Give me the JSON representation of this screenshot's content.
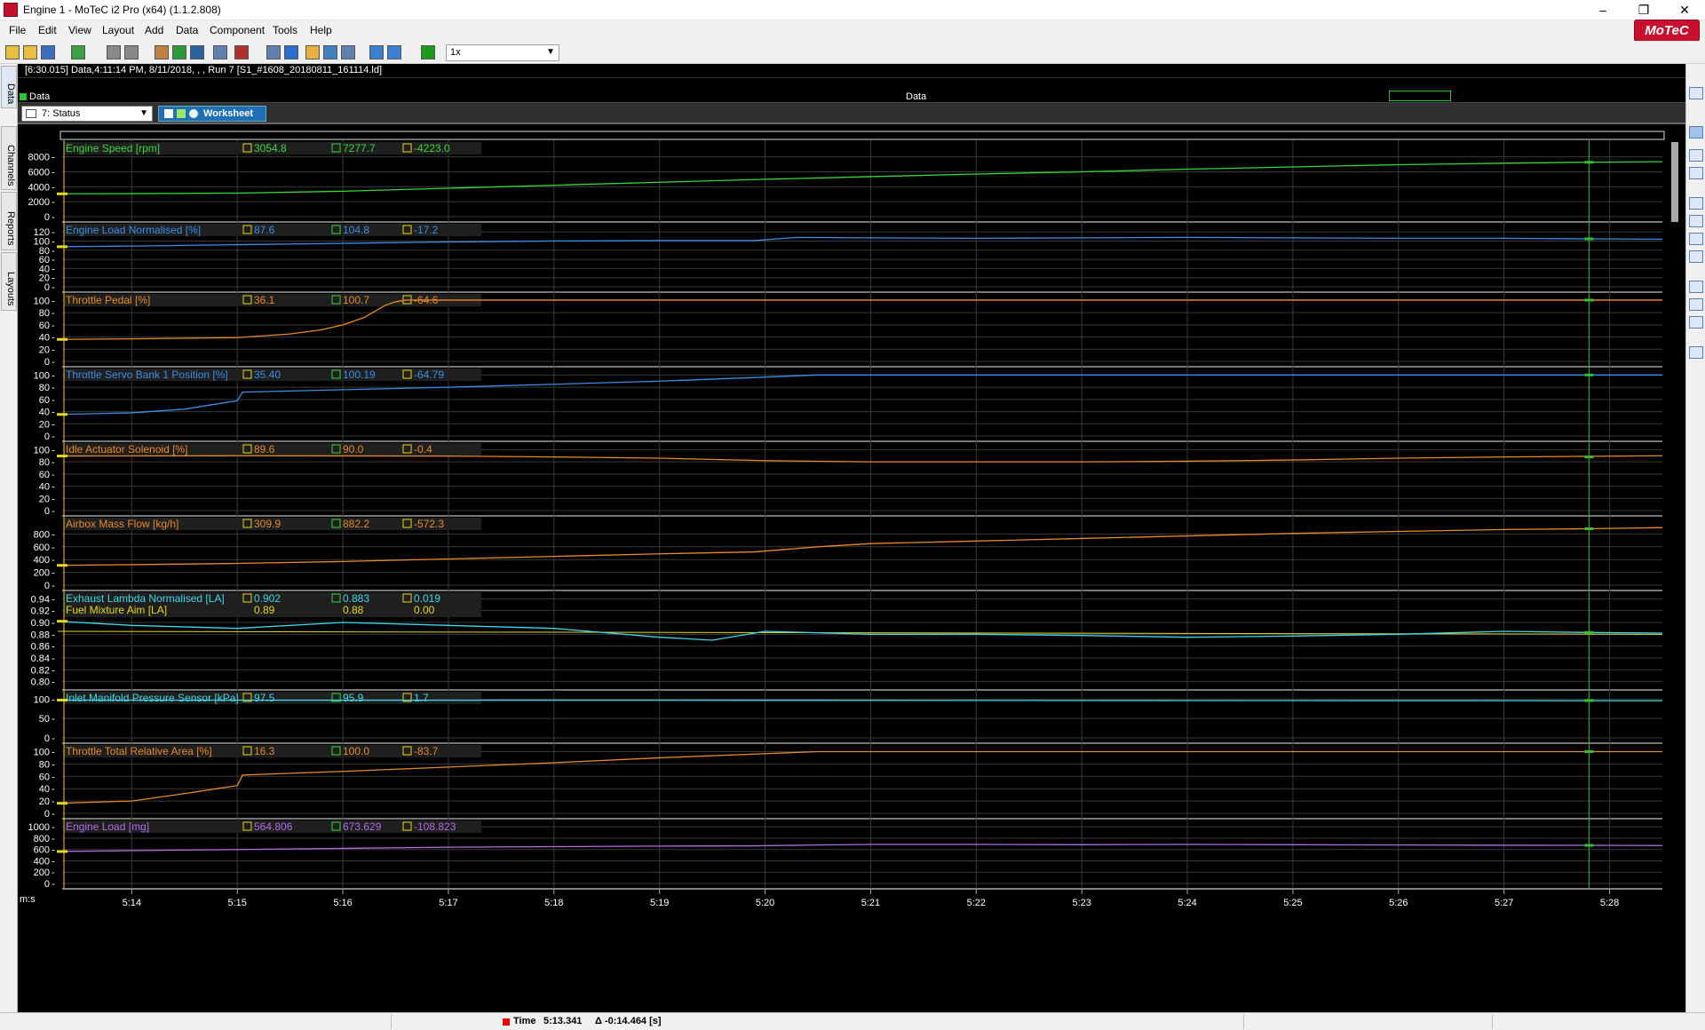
{
  "window": {
    "title": "Engine 1 - MoTeC i2 Pro (x64) (1.1.2.808)",
    "minimize": "–",
    "maximize": "❐",
    "close": "✕"
  },
  "menu": [
    "File",
    "Edit",
    "View",
    "Layout",
    "Add",
    "Data",
    "Component",
    "Tools",
    "Help"
  ],
  "brand": "MoTeC",
  "toolbar": {
    "icons": [
      "open-icon",
      "open-folder-icon",
      "save-icon",
      "download-icon",
      "print-icon",
      "print-preview-icon",
      "edit-icon",
      "excel-icon",
      "save-all-icon",
      "table-icon",
      "tree-icon",
      "grid-icon",
      "info-icon",
      "copy-icon",
      "grid-layout-icon",
      "zoom-fit-icon",
      "back-icon",
      "forward-icon",
      "play-icon"
    ],
    "playback_speed": "1x"
  },
  "left_tabs": [
    "Data",
    "Channels",
    "Reports",
    "Layouts"
  ],
  "info_bar": "[6:30.015] Data,4:11:14 PM, 8/11/2018, , , Run 7 [S1_#1608_20180811_161114.ld]",
  "data_bar": {
    "left_label": "Data",
    "center_label": "Data"
  },
  "worksheet": {
    "selector": "7: Status",
    "tab": "Worksheet"
  },
  "colors": {
    "green": "#39d739",
    "blue": "#3a8ee6",
    "orange": "#e8892a",
    "cyan": "#3fd8e8",
    "yellow": "#e8d81a",
    "purple": "#b36be6",
    "grid": "#3a3a3a",
    "cursor": "#2ec22e"
  },
  "chart_data": {
    "type": "line",
    "x_axis": {
      "label": "m:s",
      "ticks": [
        "5:14",
        "5:15",
        "5:16",
        "5:17",
        "5:18",
        "5:19",
        "5:20",
        "5:21",
        "5:22",
        "5:23",
        "5:24",
        "5:25",
        "5:26",
        "5:27",
        "5:28"
      ],
      "range": [
        313.341,
        328.5
      ],
      "cursor_time": 327.805
    },
    "panels": [
      {
        "name": "Engine Speed [rpm]",
        "color": "#39d739",
        "cursor": "3054.8",
        "ref": "7277.7",
        "delta": "-4223.0",
        "ylim": [
          0,
          9500
        ],
        "ticks": [
          "8000",
          "6000",
          "4000",
          "2000",
          "0"
        ],
        "tick_values": [
          8000,
          6000,
          4000,
          2000,
          0
        ],
        "x": [
          313.3,
          314,
          315,
          316,
          317,
          318,
          319,
          320,
          321,
          322,
          323,
          324,
          325,
          326,
          327,
          327.8,
          328.5
        ],
        "y": [
          3054,
          3080,
          3150,
          3400,
          3800,
          4200,
          4600,
          5000,
          5350,
          5700,
          6000,
          6350,
          6650,
          6950,
          7150,
          7277,
          7350
        ]
      },
      {
        "name": "Engine Load Normalised [%]",
        "color": "#3a8ee6",
        "cursor": "87.6",
        "ref": "104.8",
        "delta": "-17.2",
        "ylim": [
          0,
          130
        ],
        "ticks": [
          "120",
          "100",
          "80",
          "60",
          "40",
          "20",
          "0"
        ],
        "tick_values": [
          120,
          100,
          80,
          60,
          40,
          20,
          0
        ],
        "x": [
          313.3,
          314,
          315,
          316,
          317,
          318,
          319,
          319.9,
          320.3,
          321,
          322,
          323,
          324,
          325,
          326,
          327,
          327.8,
          328.5
        ],
        "y": [
          87.6,
          89,
          92,
          95,
          98,
          100,
          101,
          101,
          108,
          107,
          106,
          107,
          108,
          107,
          106,
          106,
          104.8,
          104
        ]
      },
      {
        "name": "Throttle Pedal [%]",
        "color": "#e8892a",
        "cursor": "36.1",
        "ref": "100.7",
        "delta": "-64.6",
        "ylim": [
          0,
          105
        ],
        "ticks": [
          "100",
          "80",
          "60",
          "40",
          "20",
          "0"
        ],
        "tick_values": [
          100,
          80,
          60,
          40,
          20,
          0
        ],
        "x": [
          313.3,
          314,
          315,
          315.5,
          315.8,
          316.0,
          316.2,
          316.3,
          316.4,
          316.5,
          316.6,
          317,
          320,
          325,
          328.5
        ],
        "y": [
          36.1,
          37,
          39,
          45,
          52,
          60,
          72,
          82,
          92,
          98,
          100.7,
          100.7,
          100.7,
          100.7,
          100.7
        ]
      },
      {
        "name": "Throttle Servo Bank 1 Position [%]",
        "color": "#3a8ee6",
        "cursor": "35.40",
        "ref": "100.19",
        "delta": "-64.79",
        "ylim": [
          0,
          105
        ],
        "ticks": [
          "100",
          "80",
          "60",
          "40",
          "20",
          "0"
        ],
        "tick_values": [
          100,
          80,
          60,
          40,
          20,
          0
        ],
        "x": [
          313.3,
          314,
          314.5,
          315,
          315.05,
          316,
          317,
          318,
          319,
          319.9,
          320.5,
          325,
          328.5
        ],
        "y": [
          35.4,
          38,
          44,
          58,
          72,
          76,
          80,
          85,
          90,
          96,
          100.19,
          100.19,
          100.19
        ]
      },
      {
        "name": "Idle Actuator Solenoid [%]",
        "color": "#e8892a",
        "cursor": "89.6",
        "ref": "90.0",
        "delta": "-0.4",
        "ylim": [
          0,
          105
        ],
        "ticks": [
          "100",
          "80",
          "60",
          "40",
          "20",
          "0"
        ],
        "tick_values": [
          100,
          80,
          60,
          40,
          20,
          0
        ],
        "x": [
          313.3,
          315,
          317,
          318,
          319,
          320,
          321,
          322,
          323,
          324,
          325,
          326,
          327,
          328.5
        ],
        "y": [
          89.6,
          90,
          89.5,
          88,
          86,
          82,
          80,
          80,
          80,
          81,
          83,
          86,
          88,
          90
        ]
      },
      {
        "name": "Airbox Mass Flow [kg/h]",
        "color": "#e8892a",
        "cursor": "309.9",
        "ref": "882.2",
        "delta": "-572.3",
        "ylim": [
          0,
          1000
        ],
        "ticks": [
          "800",
          "600",
          "400",
          "200",
          "0"
        ],
        "tick_values": [
          800,
          600,
          400,
          200,
          0
        ],
        "x": [
          313.3,
          314,
          315,
          316,
          317,
          318,
          319,
          319.9,
          320.5,
          321,
          322,
          323,
          324,
          325,
          326,
          327,
          327.8,
          328.5
        ],
        "y": [
          309.9,
          320,
          340,
          370,
          410,
          450,
          490,
          520,
          600,
          650,
          690,
          730,
          770,
          810,
          840,
          870,
          882,
          900
        ]
      },
      {
        "name": "Exhaust Lambda Normalised [LA]",
        "name2": "Fuel Mixture Aim [LA]",
        "color": "#3fd8e8",
        "color2": "#e8d81a",
        "cursor": "0.902",
        "ref": "0.883",
        "delta": "0.019",
        "cursor2": "0.89",
        "ref2": "0.88",
        "delta2": "0.00",
        "ylim": [
          0.795,
          0.945
        ],
        "ticks": [
          "0.94",
          "0.92",
          "0.90",
          "0.88",
          "0.86",
          "0.84",
          "0.82",
          "0.80"
        ],
        "tick_values": [
          0.94,
          0.92,
          0.9,
          0.88,
          0.86,
          0.84,
          0.82,
          0.8
        ],
        "x": [
          313.3,
          314,
          315,
          316,
          317,
          318,
          319,
          319.5,
          320,
          321,
          322,
          323,
          324,
          325,
          326,
          327,
          327.8,
          328.5
        ],
        "y": [
          0.902,
          0.895,
          0.89,
          0.9,
          0.895,
          0.89,
          0.875,
          0.87,
          0.885,
          0.88,
          0.88,
          0.878,
          0.875,
          0.877,
          0.88,
          0.885,
          0.883,
          0.882
        ],
        "x2": [
          313.3,
          328.5
        ],
        "y2": [
          0.885,
          0.88
        ]
      },
      {
        "name": "Inlet Manifold Pressure Sensor [kPa]",
        "color": "#3fd8e8",
        "cursor": "97.5",
        "ref": "95.9",
        "delta": "1.7",
        "ylim": [
          0,
          110
        ],
        "ticks": [
          "100",
          "50",
          "0"
        ],
        "tick_values": [
          100,
          50,
          0
        ],
        "x": [
          313.3,
          320,
          325,
          328.5
        ],
        "y": [
          97.5,
          97,
          96.2,
          95.9
        ]
      },
      {
        "name": "Throttle Total Relative Area [%]",
        "color": "#e8892a",
        "cursor": "16.3",
        "ref": "100.0",
        "delta": "-83.7",
        "ylim": [
          0,
          105
        ],
        "ticks": [
          "100",
          "80",
          "60",
          "40",
          "20",
          "0"
        ],
        "tick_values": [
          100,
          80,
          60,
          40,
          20,
          0
        ],
        "x": [
          313.3,
          314,
          314.5,
          315,
          315.05,
          316,
          317,
          318,
          319,
          319.9,
          320.5,
          325,
          328.5
        ],
        "y": [
          16.3,
          20,
          32,
          45,
          62,
          68,
          75,
          82,
          90,
          96,
          100,
          100,
          100
        ]
      },
      {
        "name": "Engine Load [mg]",
        "color": "#b36be6",
        "cursor": "564.806",
        "ref": "673.629",
        "delta": "-108.823",
        "ylim": [
          0,
          1050
        ],
        "ticks": [
          "1000",
          "800",
          "600",
          "400",
          "200",
          "0"
        ],
        "tick_values": [
          1000,
          800,
          600,
          400,
          200,
          0
        ],
        "x": [
          313.3,
          314,
          315,
          316,
          317,
          318,
          319,
          319.9,
          320.5,
          321,
          322,
          323,
          324,
          325,
          326,
          327,
          327.8,
          328.5
        ],
        "y": [
          564.8,
          580,
          600,
          620,
          640,
          650,
          660,
          665,
          680,
          690,
          690,
          685,
          690,
          685,
          680,
          675,
          673.6,
          670
        ]
      }
    ]
  },
  "status": {
    "label": "Time",
    "value": "5:13.341",
    "delta": "Δ -0:14.464 [s]"
  }
}
